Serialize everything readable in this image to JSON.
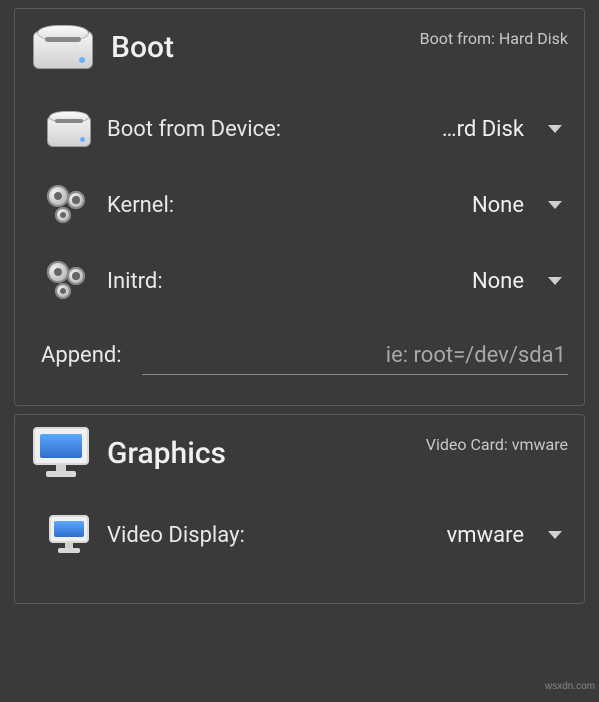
{
  "boot": {
    "title": "Boot",
    "summary_label": "Boot from:",
    "summary_value": "Hard Disk",
    "device_label": "Boot from Device:",
    "device_value": "…rd Disk",
    "kernel_label": "Kernel:",
    "kernel_value": "None",
    "initrd_label": "Initrd:",
    "initrd_value": "None",
    "append_label": "Append:",
    "append_placeholder": "ie: root=/dev/sda1",
    "append_value": ""
  },
  "graphics": {
    "title": "Graphics",
    "summary_label": "Video Card:",
    "summary_value": "vmware",
    "display_label": "Video Display:",
    "display_value": "vmware"
  },
  "watermark": "wsxdn.com"
}
